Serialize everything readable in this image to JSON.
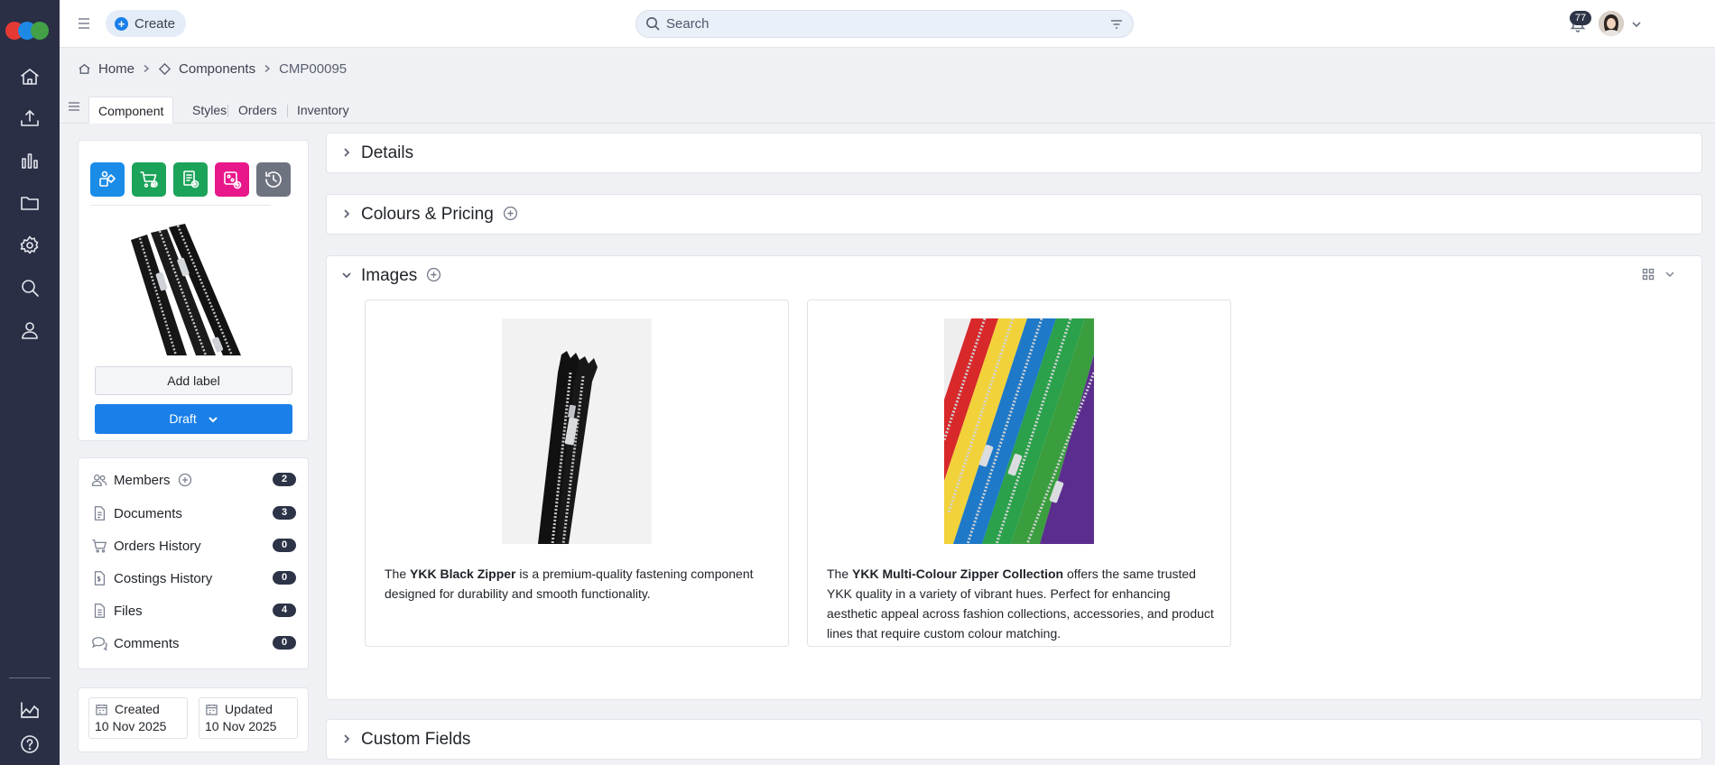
{
  "topbar": {
    "create_label": "Create",
    "search_placeholder": "Search",
    "notification_count": "77"
  },
  "breadcrumb": {
    "home": "Home",
    "components": "Components",
    "current": "CMP00095"
  },
  "tabs": [
    {
      "label": "Component",
      "active": true
    },
    {
      "label": "Styles",
      "active": false
    },
    {
      "label": "Orders",
      "active": false
    },
    {
      "label": "Inventory",
      "active": false
    }
  ],
  "component_card": {
    "quick_action_icons": [
      "components-icon",
      "add-to-cart-icon",
      "costing-icon",
      "colour-icon",
      "history-icon"
    ],
    "quick_action_colors": [
      "#1a8ce8",
      "#1ba35a",
      "#1ba35a",
      "#e8178a",
      "#6e7380"
    ],
    "add_label": "Add label",
    "status": "Draft"
  },
  "meta": {
    "members_label": "Members",
    "members_count": "2",
    "documents_label": "Documents",
    "documents_count": "3",
    "orders_label": "Orders History",
    "orders_count": "0",
    "costings_label": "Costings History",
    "costings_count": "0",
    "files_label": "Files",
    "files_count": "4",
    "comments_label": "Comments",
    "comments_count": "0"
  },
  "dates": {
    "created_label": "Created",
    "created_value": "10 Nov 2025",
    "updated_label": "Updated",
    "updated_value": "10 Nov 2025"
  },
  "sections": {
    "details": "Details",
    "colours_pricing": "Colours & Pricing",
    "images": "Images",
    "custom_fields": "Custom Fields"
  },
  "images": [
    {
      "caption_pre": "The ",
      "caption_bold": "YKK Black Zipper",
      "caption_post": " is a premium-quality fastening component designed for durability and smooth functionality."
    },
    {
      "caption_pre": "The ",
      "caption_bold": "YKK Multi-Colour Zipper Collection",
      "caption_post": " offers the same trusted YKK quality in a variety of vibrant hues. Perfect for enhancing aesthetic appeal across fashion collections, accessories, and product lines that require custom colour matching."
    }
  ],
  "colors": {
    "sidebar": "#2a2f45",
    "accent": "#1a7fe8",
    "badge": "#2d3447"
  }
}
